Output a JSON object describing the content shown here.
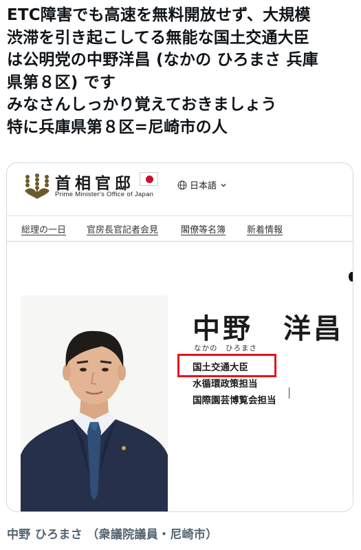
{
  "tweet": {
    "lines": [
      "ETC障害でも高速を無料開放せず、大規模",
      "渋滞を引き起こしてる無能な国土交通大臣",
      "は公明党の中野洋昌 (なかの ひろまさ 兵庫",
      "県第８区) です",
      "みなさんしっかり覚えておきましょう",
      "特に兵庫県第８区=尼崎市の人"
    ]
  },
  "card": {
    "site": {
      "title": "首相官邸",
      "subtitle": "Prime Minister's Office of Japan",
      "language": "日本語",
      "icons": {
        "emblem": "paulownia-emblem",
        "flag": "japan-flag",
        "language": "globe-icon",
        "dropdown": "chevron-down-icon"
      }
    },
    "nav": {
      "items": [
        "総理の一日",
        "官房長官記者会見",
        "閣僚等名簿",
        "新着情報"
      ]
    },
    "profile": {
      "name": "中野　洋昌",
      "kana": "なかの　ひろまさ",
      "roles": [
        "国土交通大臣",
        "水循環政策担当",
        "国際園芸博覧会担当"
      ]
    },
    "colors": {
      "highlight": "#e0141e",
      "flag_sun": "#c8102e"
    }
  },
  "caption": "中野 ひろまさ （衆議院議員・尼崎市）"
}
